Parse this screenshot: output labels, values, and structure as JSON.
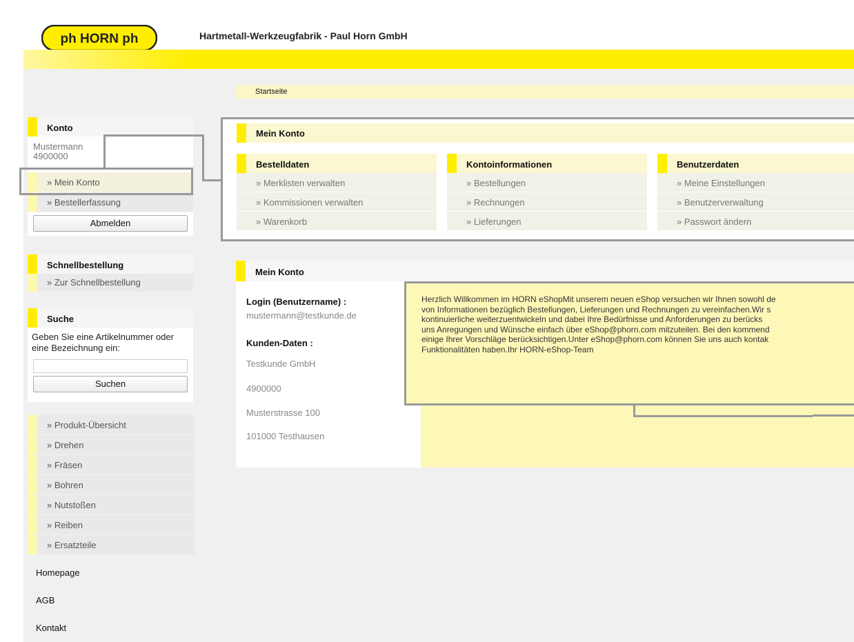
{
  "header": {
    "logo_text": "ph HORN ph",
    "company": "Hartmetall-Werkzeugfabrik - Paul Horn GmbH",
    "brand_color": "#ffee00"
  },
  "breadcrumb": "Startseite",
  "sidebar": {
    "account": {
      "title": "Konto",
      "user_name": "Mustermann",
      "user_number": "4900000",
      "links": [
        "» Mein Konto",
        "» Bestellerfassung"
      ],
      "logout": "Abmelden"
    },
    "quick_order": {
      "title": "Schnellbestellung",
      "link": "» Zur Schnellbestellung"
    },
    "search": {
      "title": "Suche",
      "hint": "Geben Sie eine Artikelnummer oder eine Bezeichnung ein:",
      "button": "Suchen",
      "placeholder": ""
    },
    "categories": [
      "» Produkt-Übersicht",
      "» Drehen",
      "» Fräsen",
      "» Bohren",
      "» Nutstoßen",
      "» Reiben",
      "» Ersatzteile"
    ],
    "footer_links": [
      "Homepage",
      "AGB",
      "Kontakt"
    ]
  },
  "main": {
    "panel_title": "Mein Konto",
    "columns": [
      {
        "title": "Bestelldaten",
        "links": [
          "» Merklisten verwalten",
          "» Kommissionen verwalten",
          "» Warenkorb"
        ]
      },
      {
        "title": "Kontoinformationen",
        "links": [
          "» Bestellungen",
          "» Rechnungen",
          "» Lieferungen"
        ]
      },
      {
        "title": "Benutzerdaten",
        "links": [
          "» Meine Einstellungen",
          "» Benutzerverwaltung",
          "» Passwort ändern"
        ]
      }
    ],
    "details": {
      "title": "Mein Konto",
      "login_label": "Login (Benutzername) :",
      "login_value": "mustermann@testkunde.de",
      "customer_label": "Kunden-Daten :",
      "company": "Testkunde GmbH",
      "number": "4900000",
      "street": "Musterstrasse 100",
      "city": "101000 Testhausen"
    },
    "welcome_lines": [
      "Herzlich Willkommen im HORN eShopMit unserem neuen eShop versuchen wir Ihnen sowohl de",
      "von Informationen bezüglich Bestellungen, Lieferungen und Rechnungen zu vereinfachen.Wir s",
      "kontinuierliche weiterzuentwickeln und dabei Ihre Bedürfnisse und Anforderungen zu berücks",
      "uns Anregungen und Wünsche einfach über eShop@phorn.com mitzuteilen. Bei den kommend",
      "einige Ihrer Vorschläge berücksichtigen.Unter eShop@phorn.com können Sie uns auch kontak",
      "Funktionalitäten haben.Ihr HORN-eShop-Team"
    ]
  }
}
